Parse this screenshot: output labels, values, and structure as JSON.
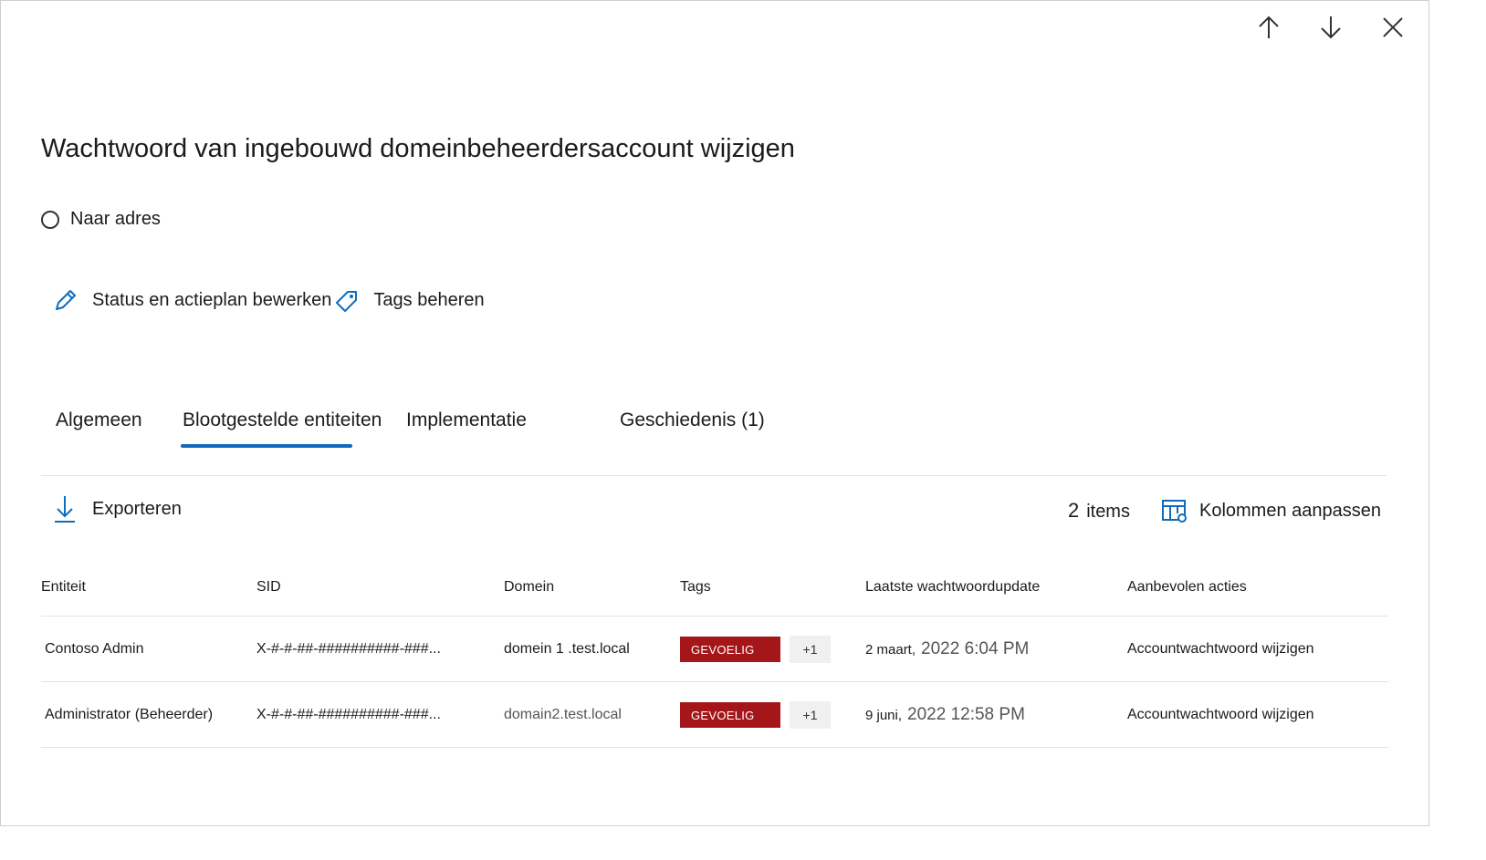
{
  "title": "Wachtwoord van ingebouwd domeinbeheerdersaccount wijzigen",
  "status": {
    "label": "Naar adres"
  },
  "actions": {
    "edit_label": "Status en actieplan bewerken",
    "tags_label": "Tags beheren"
  },
  "tabs": [
    {
      "label": "Algemeen"
    },
    {
      "label": "Blootgestelde entiteiten"
    },
    {
      "label": "Implementatie"
    },
    {
      "label": "Geschiedenis (1)"
    }
  ],
  "active_tab": "Blootgestelde entiteiten",
  "toolbar": {
    "export_label": "Exporteren",
    "count_number": "2",
    "count_label": "items",
    "columns_label": "Kolommen aanpassen"
  },
  "table": {
    "headers": [
      "Entiteit",
      "SID",
      "Domein",
      "Tags",
      "Laatste wachtwoordupdate",
      "Aanbevolen acties"
    ],
    "rows": [
      {
        "entity": "Contoso Admin",
        "sid": "X-#-#-##-##########-###...",
        "domain": "domein 1 .test.local",
        "tag": "GEVOELIG",
        "extra": "+1",
        "date": "2 maart,",
        "time": "2022 6:04 PM",
        "action": "Accountwachtwoord wijzigen"
      },
      {
        "entity": "Administrator (Beheerder)",
        "sid": "X-#-#-##-##########-###...",
        "domain": "domain2.test.local",
        "tag": "GEVOELIG",
        "extra": "+1",
        "date": "9 juni,",
        "time": "2022 12:58 PM",
        "action": "Accountwachtwoord wijzigen"
      }
    ]
  },
  "colors": {
    "accent": "#0f6cbd",
    "tag_red": "#a4161a"
  }
}
